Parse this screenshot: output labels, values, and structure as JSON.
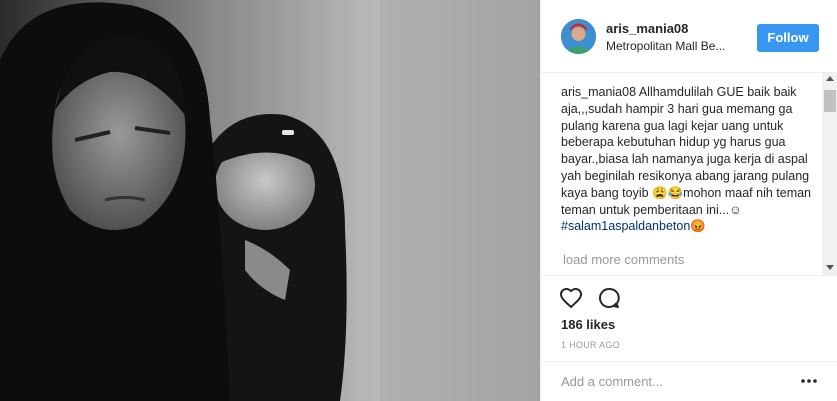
{
  "post": {
    "username": "aris_mania08",
    "location": "Metropolitan Mall Be...",
    "follow_label": "Follow",
    "caption_user": "aris_mania08",
    "caption_text": " Allhamdulilah GUE baik baik aja,,,sudah hampir 3 hari gua memang ga pulang karena gua lagi kejar uang untuk beberapa kebutuhan hidup yg harus gua bayar.,biasa lah namanya juga kerja di aspal yah beginilah resikonya abang jarang pulang kaya bang toyib 😩😂mohon maaf nih teman teman untuk pemberitaan ini...☺",
    "hashtag": "#salam1aspaldanbeton😡",
    "load_more": "load more comments",
    "likes": "186 likes",
    "time": "1 HOUR AGO",
    "comment_placeholder": "Add a comment...",
    "more_label": "•••"
  },
  "icons": {
    "heart": "heart-icon",
    "comment": "comment-bubble-icon",
    "more": "more-options-icon"
  },
  "colors": {
    "follow_bg": "#3897f0",
    "hashtag": "#003569",
    "muted": "#999999",
    "text": "#262626"
  }
}
